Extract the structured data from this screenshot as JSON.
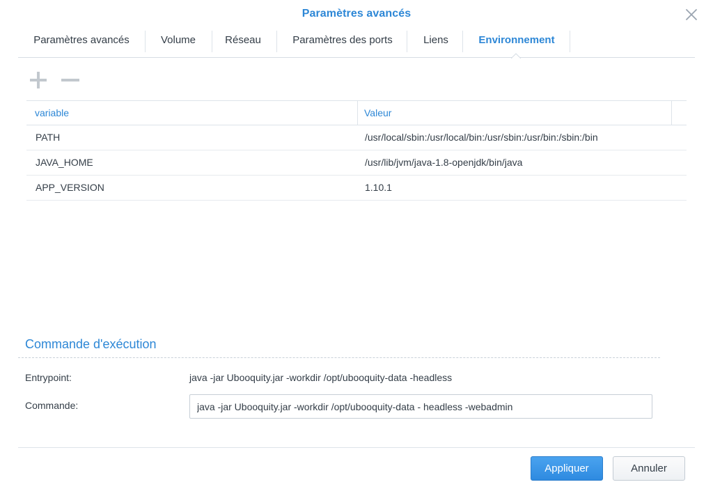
{
  "dialog": {
    "title": "Paramètres avancés"
  },
  "tabs": [
    {
      "label": "Paramètres avancés"
    },
    {
      "label": "Volume"
    },
    {
      "label": "Réseau"
    },
    {
      "label": "Paramètres des ports"
    },
    {
      "label": "Liens"
    },
    {
      "label": "Environnement",
      "active": true
    }
  ],
  "toolbar": {
    "add_icon": "plus-icon",
    "remove_icon": "minus-icon"
  },
  "env_table": {
    "columns": [
      "variable",
      "Valeur"
    ],
    "rows": [
      {
        "variable": "PATH",
        "value": "/usr/local/sbin:/usr/local/bin:/usr/sbin:/usr/bin:/sbin:/bin"
      },
      {
        "variable": "JAVA_HOME",
        "value": "/usr/lib/jvm/java-1.8-openjdk/bin/java"
      },
      {
        "variable": "APP_VERSION",
        "value": "1.10.1"
      }
    ]
  },
  "exec_section": {
    "title": "Commande d'exécution",
    "entrypoint_label": "Entrypoint:",
    "entrypoint_value": "java -jar Ubooquity.jar -workdir /opt/ubooquity-data -headless",
    "command_label": "Commande:",
    "command_value": "java -jar Ubooquity.jar -workdir /opt/ubooquity-data - headless -webadmin"
  },
  "footer": {
    "apply_label": "Appliquer",
    "cancel_label": "Annuler"
  },
  "colors": {
    "accent": "#2d87d6",
    "text": "#333d47",
    "border": "#dde3e9"
  }
}
